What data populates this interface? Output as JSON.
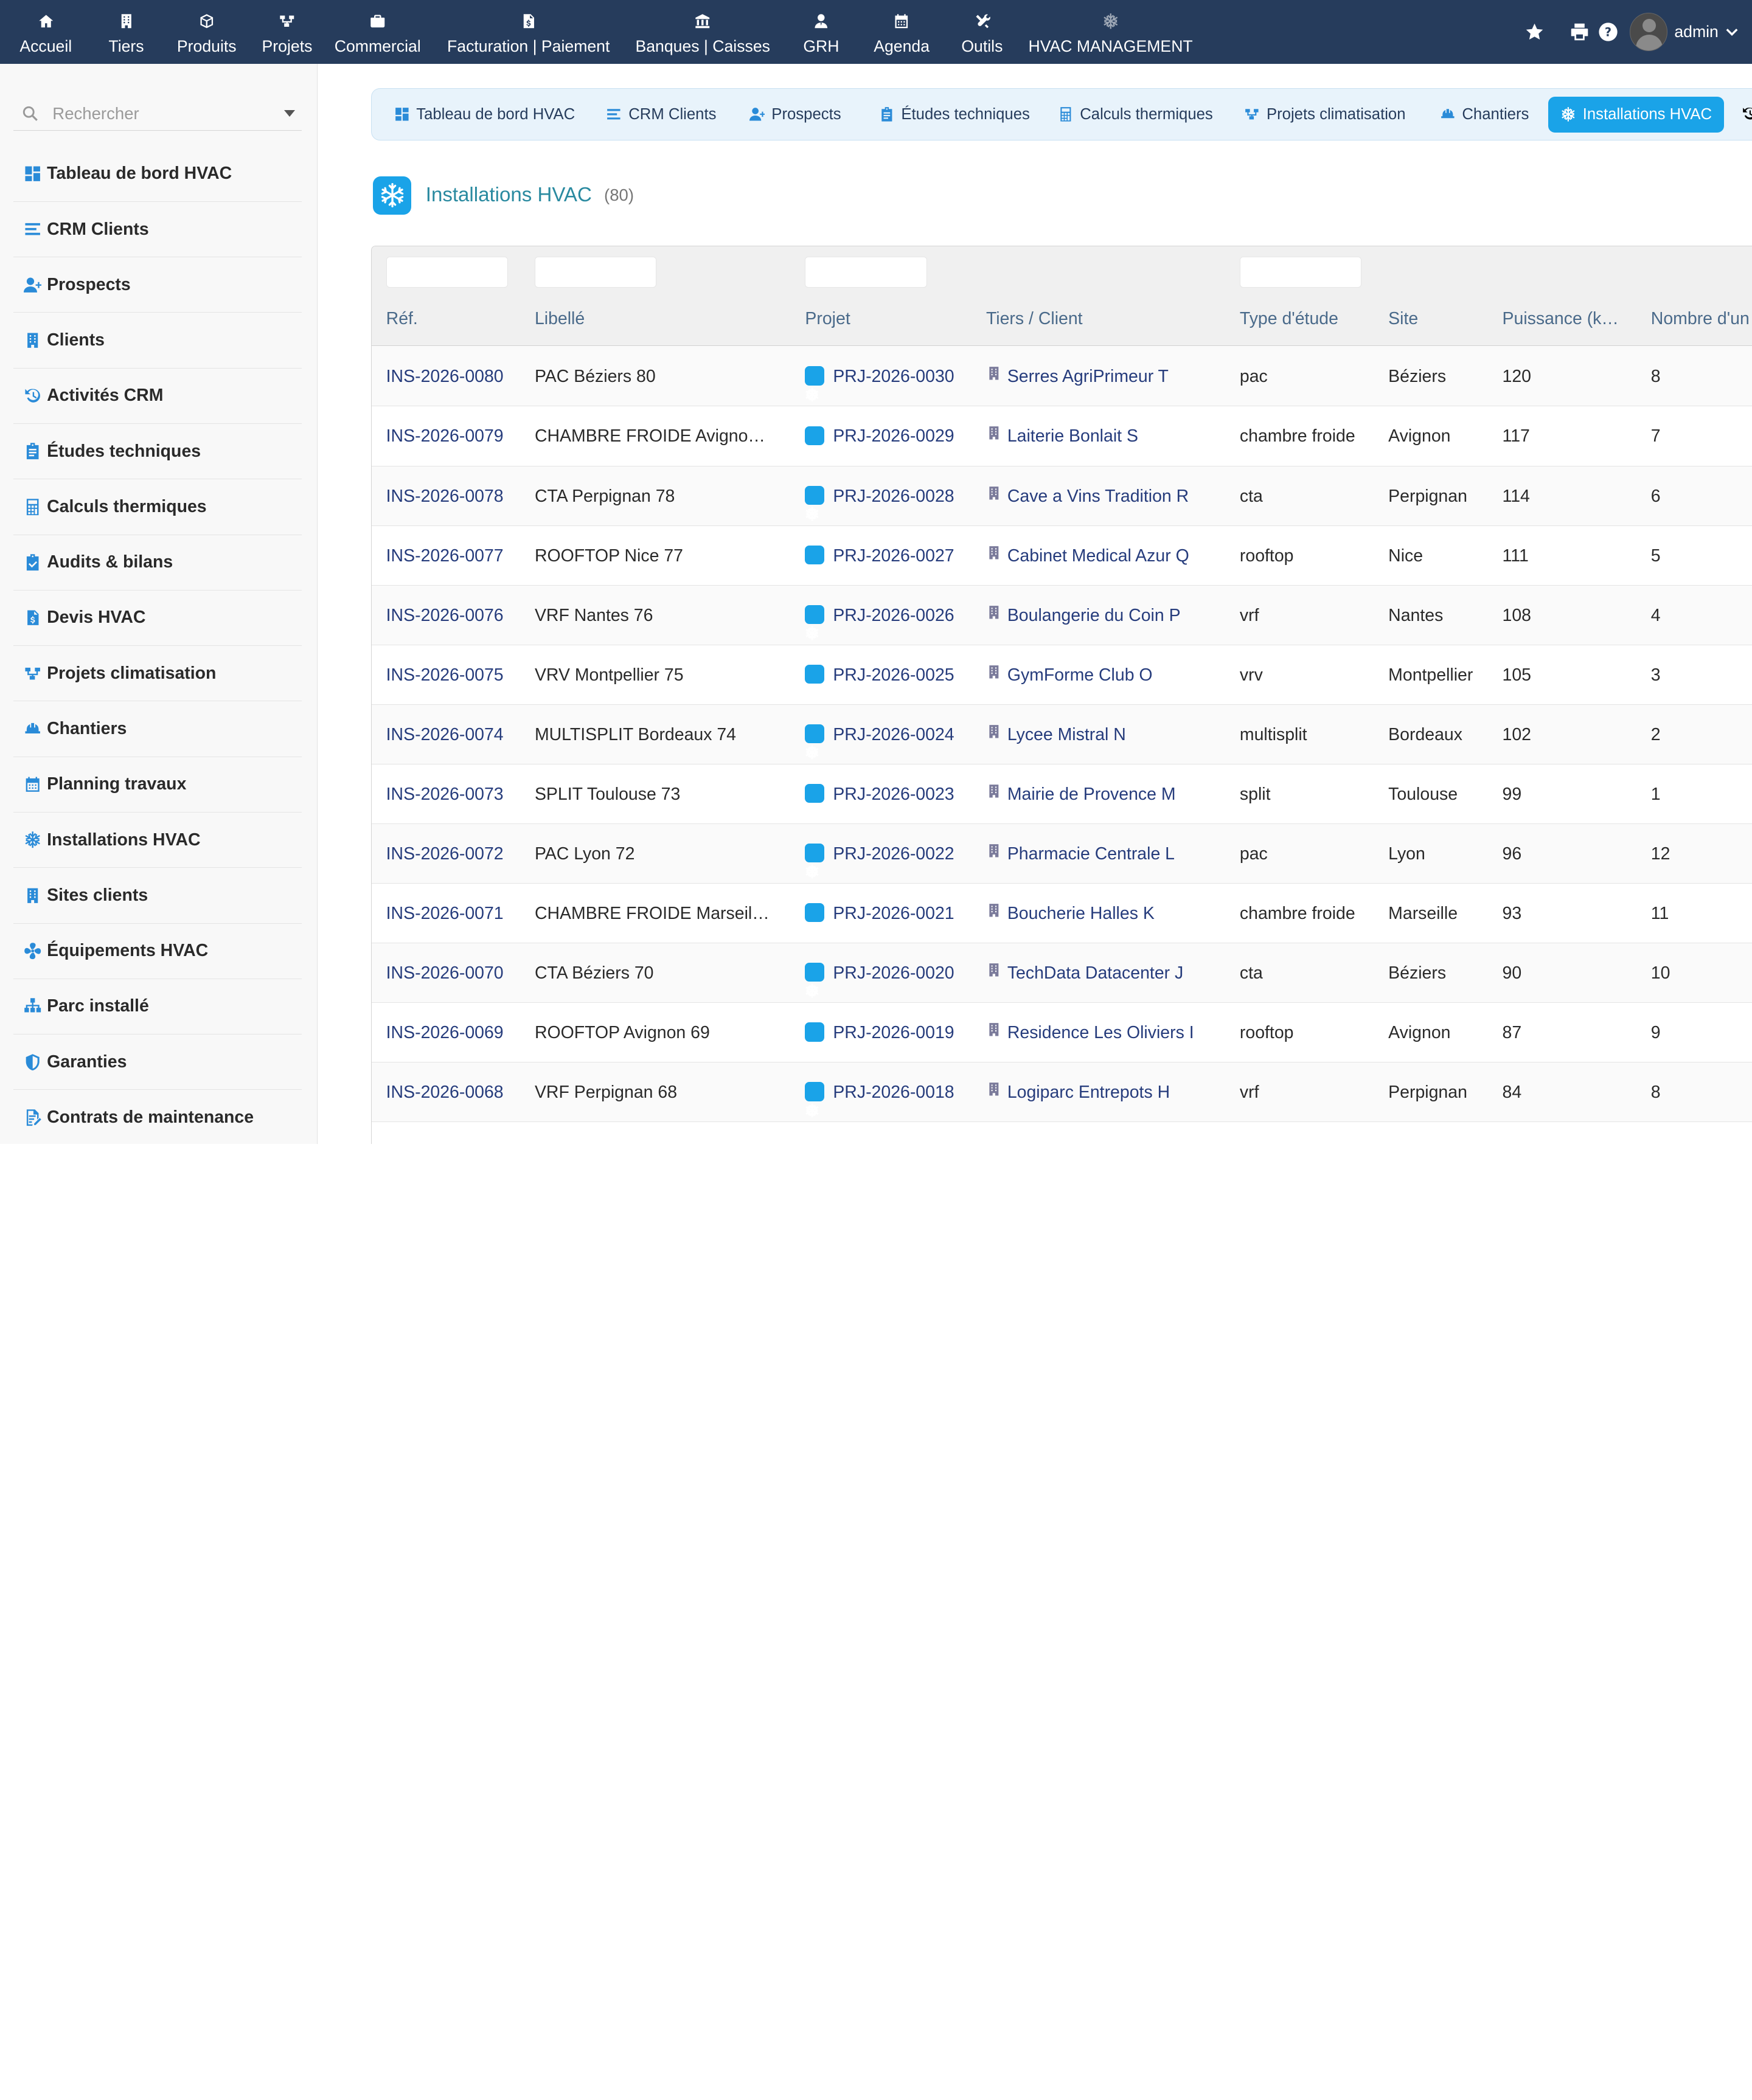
{
  "topnav": [
    {
      "label": "Accueil",
      "icon": "home-icon"
    },
    {
      "label": "Tiers",
      "icon": "building-icon"
    },
    {
      "label": "Produits",
      "icon": "cube-icon"
    },
    {
      "label": "Projets",
      "icon": "project-icon"
    },
    {
      "label": "Commercial",
      "icon": "briefcase-icon"
    },
    {
      "label": "Facturation | Paiement",
      "icon": "invoice-icon"
    },
    {
      "label": "Banques | Caisses",
      "icon": "bank-icon"
    },
    {
      "label": "GRH",
      "icon": "user-tie-icon"
    },
    {
      "label": "Agenda",
      "icon": "calendar-icon"
    },
    {
      "label": "Outils",
      "icon": "tools-icon"
    },
    {
      "label": "HVAC MANAGEMENT",
      "icon": "snowflake-icon"
    }
  ],
  "user": {
    "name": "admin"
  },
  "sidebar": {
    "search_placeholder": "Rechercher",
    "items": [
      {
        "label": "Tableau de bord HVAC",
        "icon": "dashboard-icon"
      },
      {
        "label": "CRM Clients",
        "icon": "list-icon"
      },
      {
        "label": "Prospects",
        "icon": "user-plus-icon"
      },
      {
        "label": "Clients",
        "icon": "building-icon"
      },
      {
        "label": "Activités CRM",
        "icon": "history-icon"
      },
      {
        "label": "Études techniques",
        "icon": "clipboard-icon"
      },
      {
        "label": "Calculs thermiques",
        "icon": "calculator-icon"
      },
      {
        "label": "Audits & bilans",
        "icon": "clipboard-check-icon"
      },
      {
        "label": "Devis HVAC",
        "icon": "invoice-icon"
      },
      {
        "label": "Projets climatisation",
        "icon": "project-icon"
      },
      {
        "label": "Chantiers",
        "icon": "hard-hat-icon"
      },
      {
        "label": "Planning travaux",
        "icon": "calendar-icon"
      },
      {
        "label": "Installations HVAC",
        "icon": "snowflake-icon"
      },
      {
        "label": "Sites clients",
        "icon": "building-icon"
      },
      {
        "label": "Équipements HVAC",
        "icon": "fan-icon"
      },
      {
        "label": "Parc installé",
        "icon": "network-icon"
      },
      {
        "label": "Garanties",
        "icon": "shield-icon"
      },
      {
        "label": "Contrats de maintenance",
        "icon": "contract-icon"
      }
    ]
  },
  "tabs": [
    {
      "label": "Tableau de bord HVAC",
      "icon": "dashboard-icon",
      "active": false
    },
    {
      "label": "CRM Clients",
      "icon": "list-icon",
      "active": false
    },
    {
      "label": "Prospects",
      "icon": "user-plus-icon",
      "active": false
    },
    {
      "label": "Études techniques",
      "icon": "clipboard-icon",
      "active": false
    },
    {
      "label": "Calculs thermiques",
      "icon": "calculator-icon",
      "active": false
    },
    {
      "label": "Projets climatisation",
      "icon": "project-icon",
      "active": false
    },
    {
      "label": "Chantiers",
      "icon": "hard-hat-icon",
      "active": false
    },
    {
      "label": "Installations HVAC",
      "icon": "snowflake-icon",
      "active": true
    }
  ],
  "page": {
    "title": "Installations HVAC",
    "count": "(80)"
  },
  "table": {
    "columns": [
      "Réf.",
      "Libellé",
      "Projet",
      "Tiers / Client",
      "Type d'étude",
      "Site",
      "Puissance (k…",
      "Nombre d'un"
    ],
    "rows": [
      [
        "INS-2026-0080",
        "PAC Béziers 80",
        "PRJ-2026-0030",
        "Serres AgriPrimeur T",
        "pac",
        "Béziers",
        "120",
        "8"
      ],
      [
        "INS-2026-0079",
        "CHAMBRE FROIDE Avigno…",
        "PRJ-2026-0029",
        "Laiterie Bonlait S",
        "chambre froide",
        "Avignon",
        "117",
        "7"
      ],
      [
        "INS-2026-0078",
        "CTA Perpignan 78",
        "PRJ-2026-0028",
        "Cave a Vins Tradition R",
        "cta",
        "Perpignan",
        "114",
        "6"
      ],
      [
        "INS-2026-0077",
        "ROOFTOP Nice 77",
        "PRJ-2026-0027",
        "Cabinet Medical Azur Q",
        "rooftop",
        "Nice",
        "111",
        "5"
      ],
      [
        "INS-2026-0076",
        "VRF Nantes 76",
        "PRJ-2026-0026",
        "Boulangerie du Coin P",
        "vrf",
        "Nantes",
        "108",
        "4"
      ],
      [
        "INS-2026-0075",
        "VRV Montpellier 75",
        "PRJ-2026-0025",
        "GymForme Club O",
        "vrv",
        "Montpellier",
        "105",
        "3"
      ],
      [
        "INS-2026-0074",
        "MULTISPLIT Bordeaux 74",
        "PRJ-2026-0024",
        "Lycee Mistral N",
        "multisplit",
        "Bordeaux",
        "102",
        "2"
      ],
      [
        "INS-2026-0073",
        "SPLIT Toulouse 73",
        "PRJ-2026-0023",
        "Mairie de Provence M",
        "split",
        "Toulouse",
        "99",
        "1"
      ],
      [
        "INS-2026-0072",
        "PAC Lyon 72",
        "PRJ-2026-0022",
        "Pharmacie Centrale L",
        "pac",
        "Lyon",
        "96",
        "12"
      ],
      [
        "INS-2026-0071",
        "CHAMBRE FROIDE Marseil…",
        "PRJ-2026-0021",
        "Boucherie Halles K",
        "chambre froide",
        "Marseille",
        "93",
        "11"
      ],
      [
        "INS-2026-0070",
        "CTA Béziers 70",
        "PRJ-2026-0020",
        "TechData Datacenter J",
        "cta",
        "Béziers",
        "90",
        "10"
      ],
      [
        "INS-2026-0069",
        "ROOFTOP Avignon 69",
        "PRJ-2026-0019",
        "Residence Les Oliviers I",
        "rooftop",
        "Avignon",
        "87",
        "9"
      ],
      [
        "INS-2026-0068",
        "VRF Perpignan 68",
        "PRJ-2026-0018",
        "Logiparc Entrepots H",
        "vrf",
        "Perpignan",
        "84",
        "8"
      ],
      [
        "",
        "",
        "",
        "",
        "",
        "",
        "",
        ""
      ]
    ]
  },
  "colors": {
    "topbar": "#263c5c",
    "accent": "#1aa3e8",
    "link": "#263c7c",
    "icon": "#2a8bd8"
  }
}
